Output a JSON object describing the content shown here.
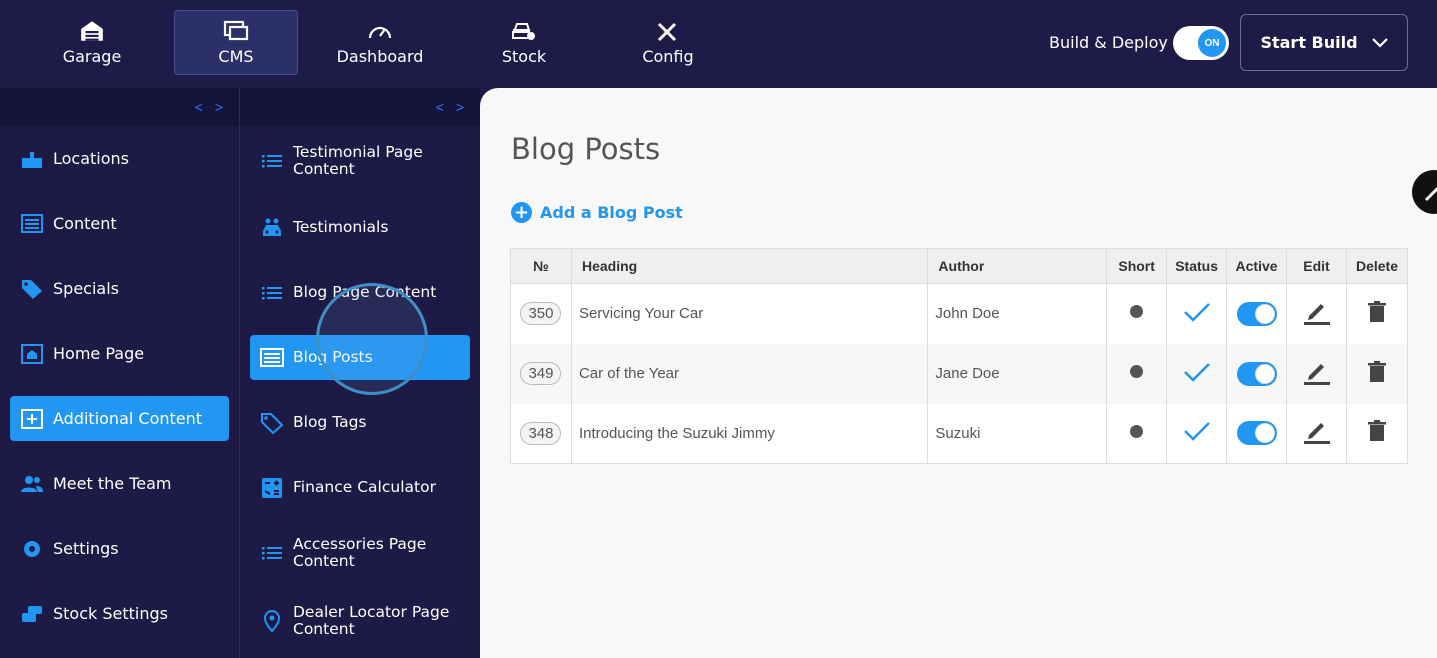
{
  "topnav": {
    "items": [
      {
        "label": "Garage",
        "icon": "garage-icon"
      },
      {
        "label": "CMS",
        "icon": "cms-icon"
      },
      {
        "label": "Dashboard",
        "icon": "speedometer-icon"
      },
      {
        "label": "Stock",
        "icon": "car-gear-icon"
      },
      {
        "label": "Config",
        "icon": "tools-icon"
      }
    ],
    "active": "CMS",
    "build_deploy_label": "Build & Deploy",
    "toggle_label": "ON",
    "start_build_label": "Start Build"
  },
  "sidebar": {
    "collapse_label": "< >",
    "items": [
      {
        "label": "Locations",
        "icon": "location-icon"
      },
      {
        "label": "Content",
        "icon": "content-icon"
      },
      {
        "label": "Specials",
        "icon": "tags-icon"
      },
      {
        "label": "Home Page",
        "icon": "home-icon"
      },
      {
        "label": "Additional Content",
        "icon": "add-box-icon"
      },
      {
        "label": "Meet the Team",
        "icon": "team-icon"
      },
      {
        "label": "Settings",
        "icon": "settings-icon"
      },
      {
        "label": "Stock Settings",
        "icon": "cars-icon"
      }
    ],
    "active": "Additional Content"
  },
  "subsidebar": {
    "collapse_label": "< >",
    "items": [
      {
        "label": "Testimonial Page Content",
        "icon": "list-icon"
      },
      {
        "label": "Testimonials",
        "icon": "car-people-icon"
      },
      {
        "label": "Blog Page Content",
        "icon": "list-icon"
      },
      {
        "label": "Blog Posts",
        "icon": "article-icon"
      },
      {
        "label": "Blog Tags",
        "icon": "tags-icon"
      },
      {
        "label": "Finance Calculator",
        "icon": "calculator-icon"
      },
      {
        "label": "Accessories Page Content",
        "icon": "list-icon"
      },
      {
        "label": "Dealer Locator Page Content",
        "icon": "pin-icon"
      }
    ],
    "active": "Blog Posts"
  },
  "main": {
    "title": "Blog Posts",
    "add_label": "Add a Blog Post",
    "table": {
      "headers": [
        "№",
        "Heading",
        "Author",
        "Short",
        "Status",
        "Active",
        "Edit",
        "Delete"
      ],
      "rows": [
        {
          "id": "350",
          "heading": "Servicing Your Car",
          "author": "John Doe",
          "active": true
        },
        {
          "id": "349",
          "heading": "Car of the Year",
          "author": "Jane Doe",
          "active": true
        },
        {
          "id": "348",
          "heading": "Introducing the Suzuki Jimmy",
          "author": "Suzuki",
          "active": true
        }
      ]
    }
  },
  "colors": {
    "nav_bg": "#1f1b48",
    "accent": "#2196f3"
  }
}
